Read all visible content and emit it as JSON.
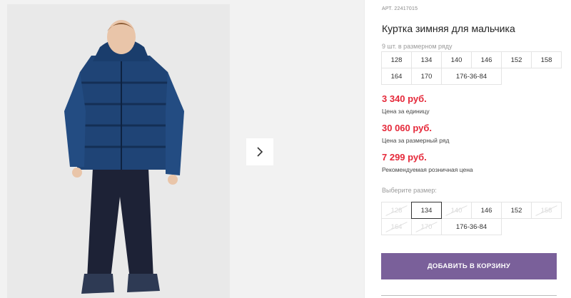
{
  "product": {
    "article": "АРТ. 22417015",
    "title": "Куртка зимняя для мальчика"
  },
  "gallery": {
    "image_alt": "Мальчик в зимней куртке",
    "next_icon": "chevron-right-icon"
  },
  "pack": {
    "label": "9 шт. в размерном ряду",
    "sizes": [
      "128",
      "134",
      "140",
      "146",
      "152",
      "158",
      "164",
      "170",
      "176-36-84"
    ]
  },
  "prices": [
    {
      "value": "3 340 руб.",
      "caption": "Цена за единицу"
    },
    {
      "value": "30 060 руб.",
      "caption": "Цена за размерный ряд"
    },
    {
      "value": "7 299 руб.",
      "caption": "Рекомендуемая розничная цена"
    }
  ],
  "size_select": {
    "label": "Выберите размер:",
    "selected": "134",
    "options": [
      {
        "label": "128",
        "available": false
      },
      {
        "label": "134",
        "available": true
      },
      {
        "label": "140",
        "available": false
      },
      {
        "label": "146",
        "available": true
      },
      {
        "label": "152",
        "available": true
      },
      {
        "label": "158",
        "available": false
      },
      {
        "label": "164",
        "available": false
      },
      {
        "label": "170",
        "available": false
      },
      {
        "label": "176-36-84",
        "available": true
      }
    ]
  },
  "cart": {
    "add_label": "ДОБАВИТЬ В КОРЗИНУ"
  },
  "colors": {
    "accent": "#7a609a",
    "price": "#e5293a"
  }
}
